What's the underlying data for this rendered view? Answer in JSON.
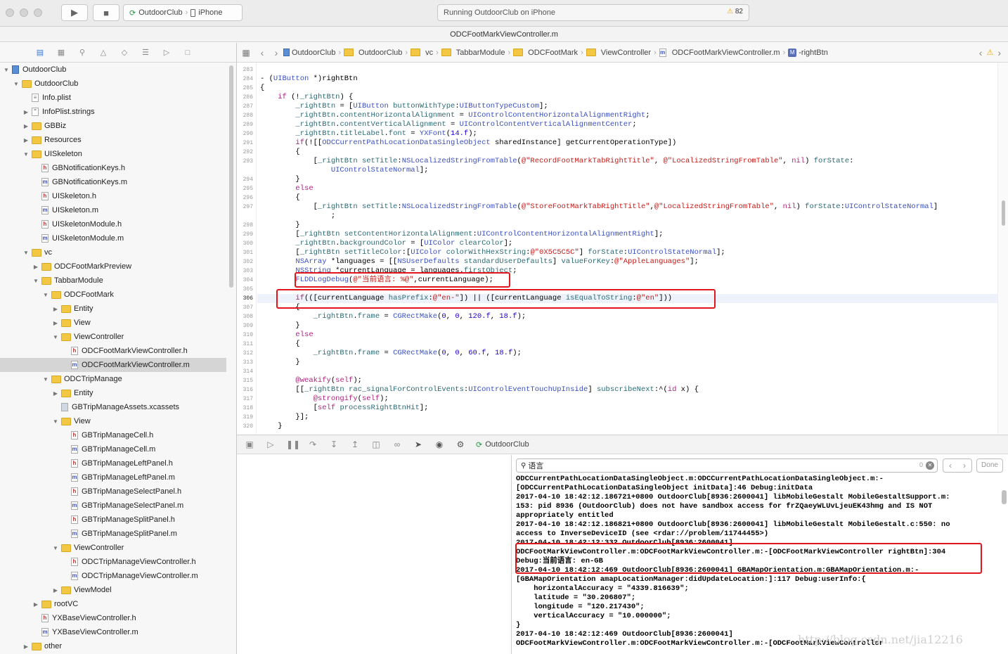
{
  "toolbar": {
    "scheme": "OutdoorClub",
    "device": "iPhone",
    "status": "Running OutdoorClub on iPhone",
    "warning_count": "82"
  },
  "window": {
    "title": "ODCFootMarkViewController.m"
  },
  "navigator": {
    "items": [
      {
        "label": "OutdoorClub",
        "depth": 0,
        "icon": "project",
        "disclosure": "open"
      },
      {
        "label": "OutdoorClub",
        "depth": 1,
        "icon": "folder",
        "disclosure": "open"
      },
      {
        "label": "Info.plist",
        "depth": 2,
        "icon": "plist",
        "disclosure": "none"
      },
      {
        "label": "InfoPlist.strings",
        "depth": 2,
        "icon": "strings",
        "disclosure": "closed"
      },
      {
        "label": "GBBiz",
        "depth": 2,
        "icon": "folder",
        "disclosure": "closed"
      },
      {
        "label": "Resources",
        "depth": 2,
        "icon": "folder",
        "disclosure": "closed"
      },
      {
        "label": "UISkeleton",
        "depth": 2,
        "icon": "folder",
        "disclosure": "open"
      },
      {
        "label": "GBNotificationKeys.h",
        "depth": 3,
        "icon": "h",
        "disclosure": "none"
      },
      {
        "label": "GBNotificationKeys.m",
        "depth": 3,
        "icon": "m",
        "disclosure": "none"
      },
      {
        "label": "UISkeleton.h",
        "depth": 3,
        "icon": "h",
        "disclosure": "none"
      },
      {
        "label": "UISkeleton.m",
        "depth": 3,
        "icon": "m",
        "disclosure": "none"
      },
      {
        "label": "UISkeletonModule.h",
        "depth": 3,
        "icon": "h",
        "disclosure": "none"
      },
      {
        "label": "UISkeletonModule.m",
        "depth": 3,
        "icon": "m",
        "disclosure": "none"
      },
      {
        "label": "vc",
        "depth": 2,
        "icon": "folder",
        "disclosure": "open"
      },
      {
        "label": "ODCFootMarkPreview",
        "depth": 3,
        "icon": "folder",
        "disclosure": "closed"
      },
      {
        "label": "TabbarModule",
        "depth": 3,
        "icon": "folder",
        "disclosure": "open"
      },
      {
        "label": "ODCFootMark",
        "depth": 4,
        "icon": "folder",
        "disclosure": "open"
      },
      {
        "label": "Entity",
        "depth": 5,
        "icon": "folder",
        "disclosure": "closed"
      },
      {
        "label": "View",
        "depth": 5,
        "icon": "folder",
        "disclosure": "closed"
      },
      {
        "label": "ViewController",
        "depth": 5,
        "icon": "folder",
        "disclosure": "open"
      },
      {
        "label": "ODCFootMarkViewController.h",
        "depth": 6,
        "icon": "h",
        "disclosure": "none"
      },
      {
        "label": "ODCFootMarkViewController.m",
        "depth": 6,
        "icon": "m",
        "disclosure": "none",
        "selected": true
      },
      {
        "label": "ODCTripManage",
        "depth": 4,
        "icon": "folder",
        "disclosure": "open"
      },
      {
        "label": "Entity",
        "depth": 5,
        "icon": "folder",
        "disclosure": "closed"
      },
      {
        "label": "GBTripManageAssets.xcassets",
        "depth": 5,
        "icon": "xcassets",
        "disclosure": "none"
      },
      {
        "label": "View",
        "depth": 5,
        "icon": "folder",
        "disclosure": "open"
      },
      {
        "label": "GBTripManageCell.h",
        "depth": 6,
        "icon": "h",
        "disclosure": "none"
      },
      {
        "label": "GBTripManageCell.m",
        "depth": 6,
        "icon": "m",
        "disclosure": "none"
      },
      {
        "label": "GBTripManageLeftPanel.h",
        "depth": 6,
        "icon": "h",
        "disclosure": "none"
      },
      {
        "label": "GBTripManageLeftPanel.m",
        "depth": 6,
        "icon": "m",
        "disclosure": "none"
      },
      {
        "label": "GBTripManageSelectPanel.h",
        "depth": 6,
        "icon": "h",
        "disclosure": "none"
      },
      {
        "label": "GBTripManageSelectPanel.m",
        "depth": 6,
        "icon": "m",
        "disclosure": "none"
      },
      {
        "label": "GBTripManageSplitPanel.h",
        "depth": 6,
        "icon": "h",
        "disclosure": "none"
      },
      {
        "label": "GBTripManageSplitPanel.m",
        "depth": 6,
        "icon": "m",
        "disclosure": "none"
      },
      {
        "label": "ViewController",
        "depth": 5,
        "icon": "folder",
        "disclosure": "open"
      },
      {
        "label": "ODCTripManageViewController.h",
        "depth": 6,
        "icon": "h",
        "disclosure": "none"
      },
      {
        "label": "ODCTripManageViewController.m",
        "depth": 6,
        "icon": "m",
        "disclosure": "none"
      },
      {
        "label": "ViewModel",
        "depth": 5,
        "icon": "folder",
        "disclosure": "closed"
      },
      {
        "label": "rootVC",
        "depth": 3,
        "icon": "folder",
        "disclosure": "closed"
      },
      {
        "label": "YXBaseViewController.h",
        "depth": 3,
        "icon": "h",
        "disclosure": "none"
      },
      {
        "label": "YXBaseViewController.m",
        "depth": 3,
        "icon": "m",
        "disclosure": "none"
      },
      {
        "label": "other",
        "depth": 2,
        "icon": "folder",
        "disclosure": "closed"
      }
    ]
  },
  "jumpbar": {
    "crumbs": [
      "OutdoorClub",
      "OutdoorClub",
      "vc",
      "TabbarModule",
      "ODCFootMark",
      "ViewController",
      "ODCFootMarkViewController.m",
      "-rightBtn"
    ]
  },
  "editor": {
    "lines": [
      {
        "n": "283",
        "t": ""
      },
      {
        "n": "284",
        "t": "- (<ty>UIButton</ty> *)rightBtn"
      },
      {
        "n": "285",
        "t": "{"
      },
      {
        "n": "286",
        "t": "    <kw>if</kw> (!<me>_rightBtn</me>) {"
      },
      {
        "n": "287",
        "t": "        <me>_rightBtn</me> = [<ty>UIButton</ty> <me>buttonWithType</me>:<ty>UIButtonTypeCustom</ty>];"
      },
      {
        "n": "288",
        "t": "        <me>_rightBtn</me>.<me>contentHorizontalAlignment</me> = <ty>UIControlContentHorizontalAlignmentRight</ty>;"
      },
      {
        "n": "289",
        "t": "        <me>_rightBtn</me>.<me>contentVerticalAlignment</me> = <ty>UIControlContentVerticalAlignmentCenter</ty>;"
      },
      {
        "n": "290",
        "t": "        <me>_rightBtn</me>.<me>titleLabel</me>.<me>font</me> = <ty>YXFont</ty>(<nu>14.f</nu>);"
      },
      {
        "n": "291",
        "t": "        <kw>if</kw>(![[<ty>ODCCurrentPathLocationDataSingleObject</ty> sharedInstance] getCurrentOperationType])"
      },
      {
        "n": "292",
        "t": "        {"
      },
      {
        "n": "293",
        "t": "            [<me>_rightBtn</me> <me>setTitle</me>:<ty>NSLocalizedStringFromTable</ty>(<st>@\"RecordFootMarkTabRightTitle\"</st>, <st>@\"LocalizedStringFromTable\"</st>, <kw>nil</kw>) <me>forState</me>:"
      },
      {
        "n": "",
        "t": "                <ty>UIControlStateNormal</ty>];"
      },
      {
        "n": "294",
        "t": "        }"
      },
      {
        "n": "295",
        "t": "        <kw>else</kw>"
      },
      {
        "n": "296",
        "t": "        {"
      },
      {
        "n": "297",
        "t": "            [<me>_rightBtn</me> <me>setTitle</me>:<ty>NSLocalizedStringFromTable</ty>(<st>@\"StoreFootMarkTabRightTitle\"</st>,<st>@\"LocalizedStringFromTable\"</st>, <kw>nil</kw>) <me>forState</me>:<ty>UIControlStateNormal</ty>]"
      },
      {
        "n": "",
        "t": "                ;"
      },
      {
        "n": "298",
        "t": "        }"
      },
      {
        "n": "299",
        "t": "        [<me>_rightBtn</me> <me>setContentHorizontalAlignment</me>:<ty>UIControlContentHorizontalAlignmentRight</ty>];"
      },
      {
        "n": "300",
        "t": "        <me>_rightBtn</me>.<me>backgroundColor</me> = [<ty>UIColor</ty> <me>clearColor</me>];"
      },
      {
        "n": "301",
        "t": "        [<me>_rightBtn</me> <me>setTitleColor</me>:[<ty>UIColor</ty> <me>colorWithHexString</me>:<st>@\"0X5C5C5C\"</st>] <me>forState</me>:<ty>UIControlStateNormal</ty>];"
      },
      {
        "n": "302",
        "t": "        <ty>NSArray</ty> *languages = [[<ty>NSUserDefaults</ty> <me>standardUserDefaults</me>] <me>valueForKey</me>:<st>@\"AppleLanguages\"</st>];"
      },
      {
        "n": "303",
        "t": "        <ty>NSString</ty> *currentLanguage = languages.<me>firstObject</me>;"
      },
      {
        "n": "304",
        "t": "        <ty>FLDDLogDebug</ty>(<st>@\"当前语言: %@\"</st>,currentLanguage);"
      },
      {
        "n": "305",
        "t": ""
      },
      {
        "n": "306",
        "t": "        <kw>if</kw>(([currentLanguage <me>hasPrefix</me>:<st>@\"en-\"</st>]) || ([currentLanguage <me>isEqualToString</me>:<st>@\"en\"</st>]))",
        "cur": true
      },
      {
        "n": "307",
        "t": "        {"
      },
      {
        "n": "308",
        "t": "            <me>_rightBtn</me>.<me>frame</me> = <ty>CGRectMake</ty>(<nu>0</nu>, <nu>0</nu>, <nu>120.f</nu>, <nu>18.f</nu>);"
      },
      {
        "n": "309",
        "t": "        }"
      },
      {
        "n": "310",
        "t": "        <kw>else</kw>"
      },
      {
        "n": "311",
        "t": "        {"
      },
      {
        "n": "312",
        "t": "            <me>_rightBtn</me>.<me>frame</me> = <ty>CGRectMake</ty>(<nu>0</nu>, <nu>0</nu>, <nu>60.f</nu>, <nu>18.f</nu>);"
      },
      {
        "n": "313",
        "t": "        }"
      },
      {
        "n": "314",
        "t": ""
      },
      {
        "n": "315",
        "t": "        <kw>@weakify</kw>(<kw>self</kw>);"
      },
      {
        "n": "316",
        "t": "        [[<me>_rightBtn</me> <me>rac_signalForControlEvents</me>:<ty>UIControlEventTouchUpInside</ty>] <me>subscribeNext</me>:^(<kw>id</kw> x) {"
      },
      {
        "n": "317",
        "t": "            <kw>@strongify</kw>(<kw>self</kw>);"
      },
      {
        "n": "318",
        "t": "            [<kw>self</kw> <me>processRightBtnHit</me>];"
      },
      {
        "n": "319",
        "t": "        }];"
      },
      {
        "n": "320",
        "t": "    }"
      }
    ]
  },
  "debugbar": {
    "target": "OutdoorClub"
  },
  "console": {
    "filter_value": "语言",
    "filter_count": "0",
    "done_label": "Done",
    "lines": [
      "ODCCurrentPathLocationDataSingleObject.m:ODCCurrentPathLocationDataSingleObject.m:-",
      "[ODCCurrentPathLocationDataSingleObject initData]:46 Debug:initData",
      "2017-04-10 18:42:12.186721+0800 OutdoorClub[8936:2600041] libMobileGestalt MobileGestaltSupport.m:",
      "153: pid 8936 (OutdoorClub) does not have sandbox access for frZQaeyWLUvLjeuEK43hmg and IS NOT",
      "appropriately entitled",
      "2017-04-10 18:42:12.186821+0800 OutdoorClub[8936:2600041] libMobileGestalt MobileGestalt.c:550: no",
      "access to InverseDeviceID (see <rdar://problem/11744455>)",
      "2017-04-10 18:42:12:332 OutdoorClub[8936:2600041]",
      "ODCFootMarkViewController.m:ODCFootMarkViewController.m:-[ODCFootMarkViewController rightBtn]:304",
      "Debug:当前语言: en-GB",
      "2017-04-10 18:42:12:469 OutdoorClub[8936:2600041] GBAMapOrientation.m:GBAMapOrientation.m:-",
      "[GBAMapOrientation amapLocationManager:didUpdateLocation:]:117 Debug:userInfo:{",
      "    horizontalAccuracy = \"4339.816639\";",
      "    latitude = \"30.206807\";",
      "    longitude = \"120.217430\";",
      "    verticalAccuracy = \"10.000000\";",
      "}",
      "2017-04-10 18:42:12:469 OutdoorClub[8936:2600041]",
      "ODCFootMarkViewController.m:ODCFootMarkViewController.m:-[ODCFootMarkViewController"
    ]
  },
  "watermark": "http://blog.csdn.net/jia12216",
  "colors": {
    "highlight": "#e0161e",
    "selection": "#d5d5d5",
    "keyword": "#b0247e",
    "string": "#c41a16",
    "type": "#3a4fbf"
  }
}
